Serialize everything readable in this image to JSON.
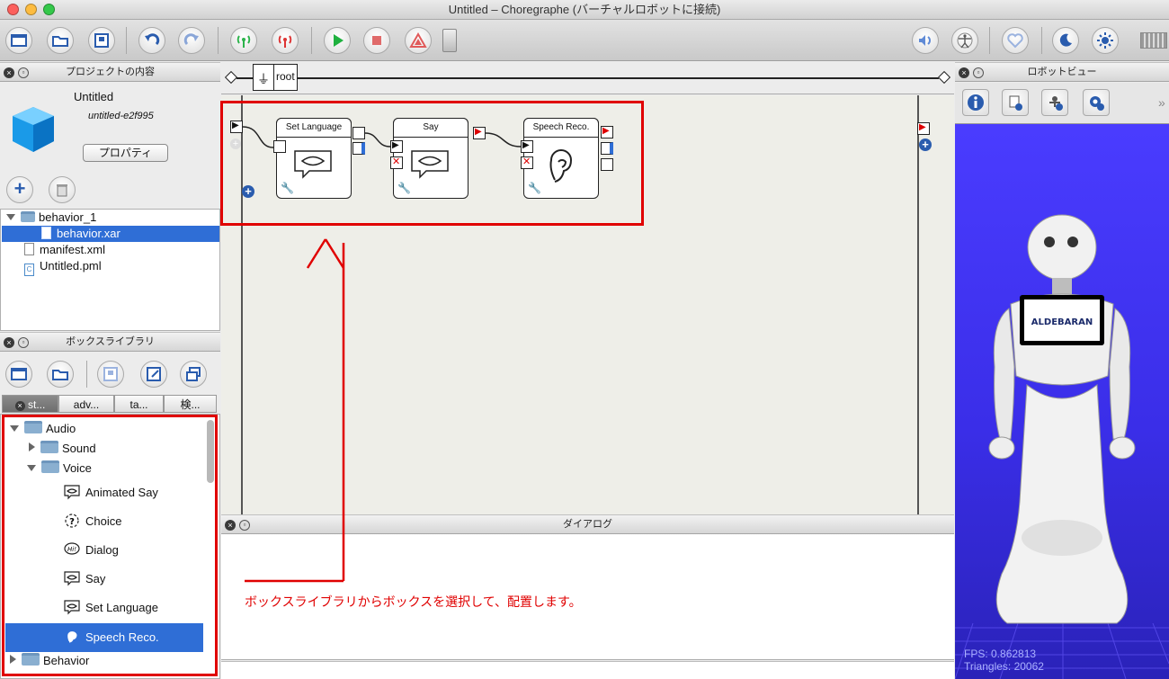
{
  "window": {
    "title": "Untitled – Choregraphe (バーチャルロボットに接続)"
  },
  "project": {
    "header": "プロジェクトの内容",
    "name": "Untitled",
    "id": "untitled-e2f995",
    "properties_button": "プロパティ",
    "tree": [
      {
        "label": "behavior_1",
        "type": "folder"
      },
      {
        "label": "behavior.xar",
        "type": "file",
        "selected": true
      },
      {
        "label": "manifest.xml",
        "type": "file"
      },
      {
        "label": "Untitled.pml",
        "type": "file"
      }
    ]
  },
  "library": {
    "header": "ボックスライブラリ",
    "tabs": [
      "st...",
      "adv...",
      "ta...",
      "検..."
    ],
    "tree": {
      "audio": "Audio",
      "sound": "Sound",
      "voice": "Voice",
      "items": [
        "Animated Say",
        "Choice",
        "Dialog",
        "Say",
        "Set Language",
        "Speech Reco."
      ],
      "behavior": "Behavior"
    }
  },
  "diagram": {
    "breadcrumb": "root",
    "boxes": [
      {
        "title": "Set Language"
      },
      {
        "title": "Say"
      },
      {
        "title": "Speech Reco."
      }
    ]
  },
  "dialog": {
    "header": "ダイアログ"
  },
  "robot": {
    "header": "ロボットビュー",
    "logo": "ALDEBARAN",
    "fps": "FPS: 0.862813",
    "triangles": "Triangles: 20062"
  },
  "annotation": {
    "text": "ボックスライブラリからボックスを選択して、配置します。"
  },
  "colors": {
    "highlight": "#e00000",
    "selection": "#2f6ed6",
    "robot_bg": "#3a2ee8"
  }
}
